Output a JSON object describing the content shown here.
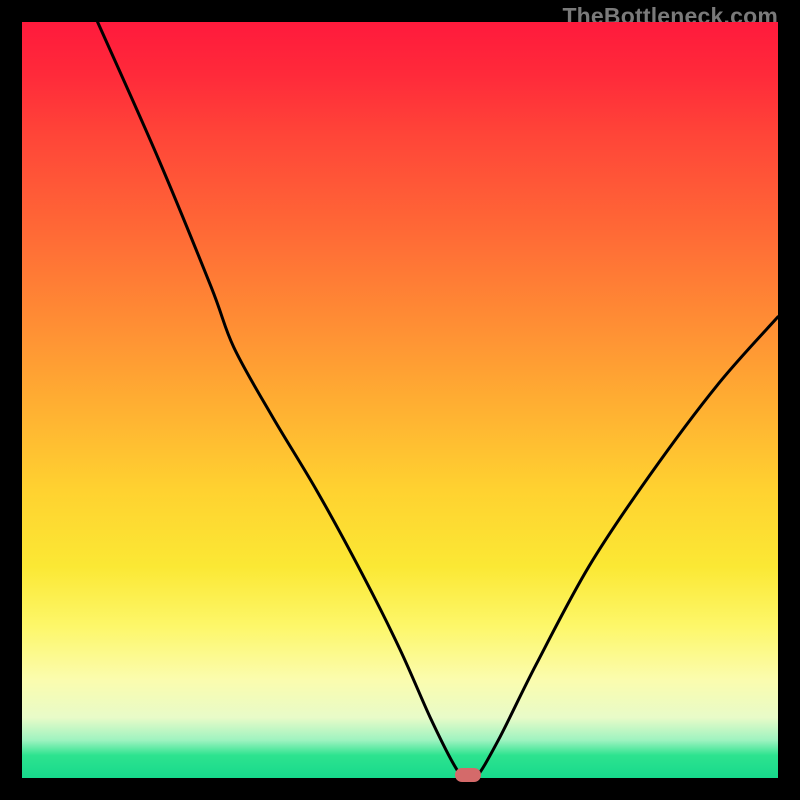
{
  "watermark": "TheBottleneck.com",
  "chart_data": {
    "type": "line",
    "title": "",
    "xlabel": "",
    "ylabel": "",
    "xlim": [
      0,
      100
    ],
    "ylim": [
      0,
      100
    ],
    "series": [
      {
        "name": "bottleneck-curve",
        "x": [
          10,
          18,
          25,
          28,
          33,
          39,
          45,
          50,
          54,
          57,
          58.5,
          60,
          63,
          68,
          75,
          83,
          92,
          100
        ],
        "y": [
          100,
          82,
          65,
          57,
          48,
          38,
          27,
          17,
          8,
          2,
          0,
          0,
          5,
          15,
          28,
          40,
          52,
          61
        ]
      }
    ],
    "marker": {
      "x": 59,
      "y": 0
    }
  },
  "colors": {
    "curve": "#000000",
    "marker": "#d46a6a",
    "frame": "#000000"
  }
}
